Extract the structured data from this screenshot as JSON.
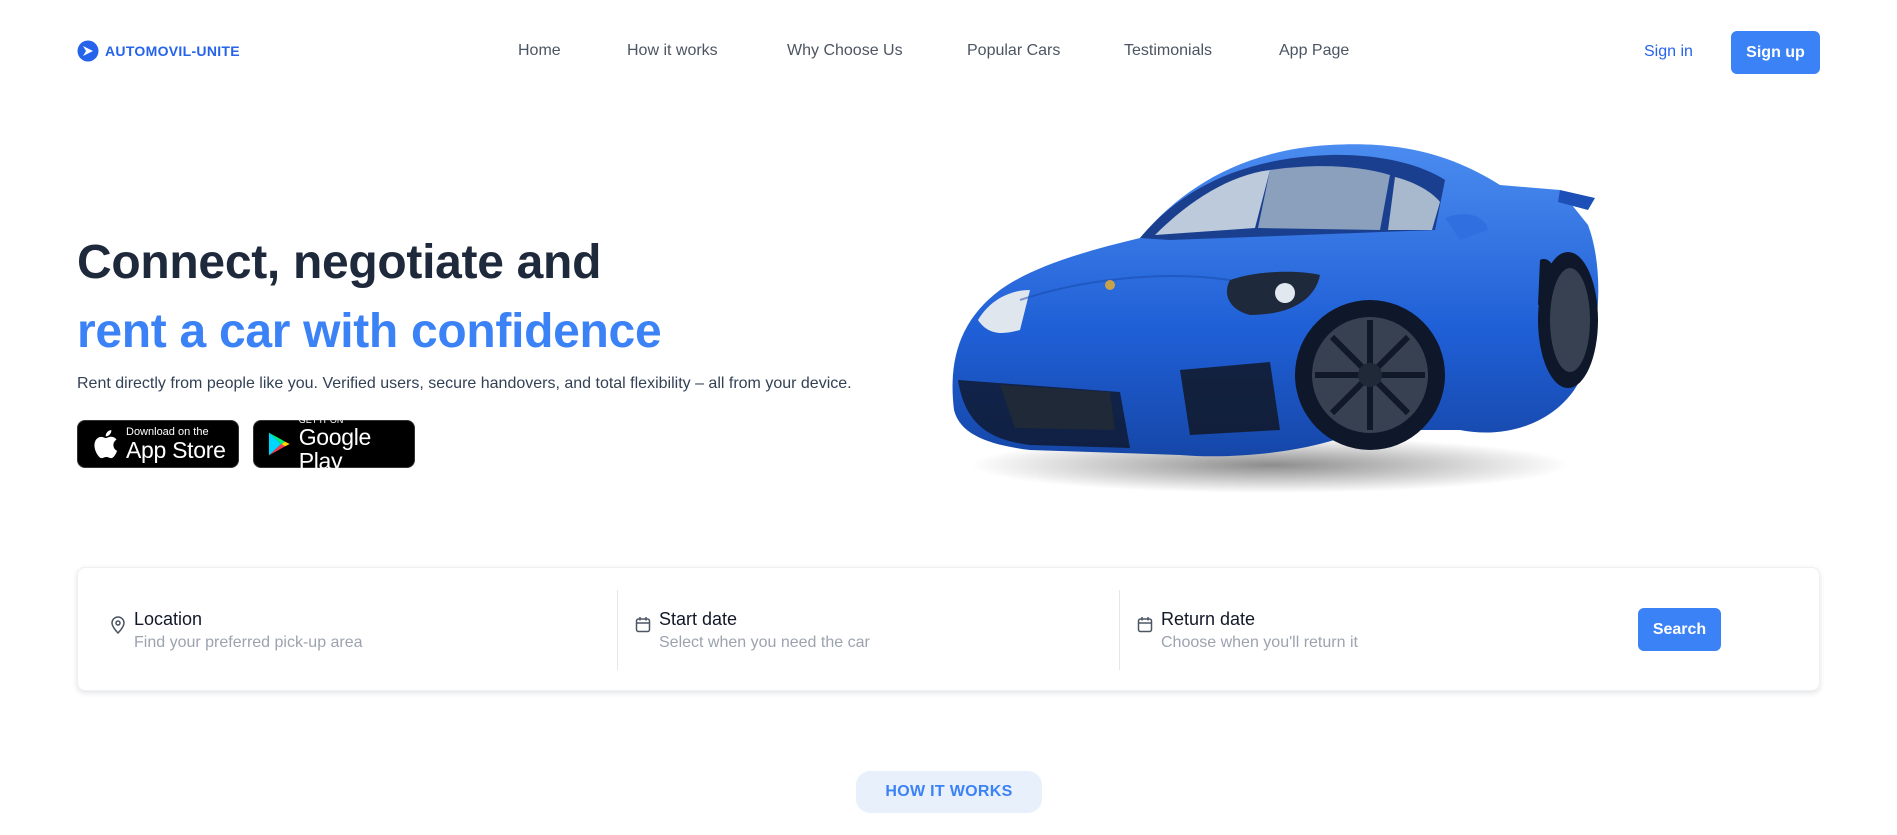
{
  "brand": {
    "name": "AUTOMOVIL-UNITE",
    "accent": "#3b82f6"
  },
  "nav": {
    "items": [
      {
        "label": "Home"
      },
      {
        "label": "How it works"
      },
      {
        "label": "Why Choose Us"
      },
      {
        "label": "Popular Cars"
      },
      {
        "label": "Testimonials"
      },
      {
        "label": "App Page"
      }
    ],
    "signin": "Sign in",
    "signup": "Sign up"
  },
  "hero": {
    "title_line1": "Connect, negotiate and",
    "title_line2": "rent a car with confidence",
    "subtitle": "Rent directly from people like you. Verified users, secure handovers, and total flexibility – all from your device.",
    "appstore_small": "Download on the",
    "appstore_big": "App Store",
    "googleplay_small": "GET IT ON",
    "googleplay_big": "Google Play"
  },
  "search": {
    "location_label": "Location",
    "location_hint": "Find your preferred pick-up area",
    "start_label": "Start date",
    "start_hint": "Select when you need the car",
    "return_label": "Return date",
    "return_hint": "Choose when you'll return it",
    "button": "Search"
  },
  "section": {
    "how_it_works": "HOW IT WORKS"
  }
}
